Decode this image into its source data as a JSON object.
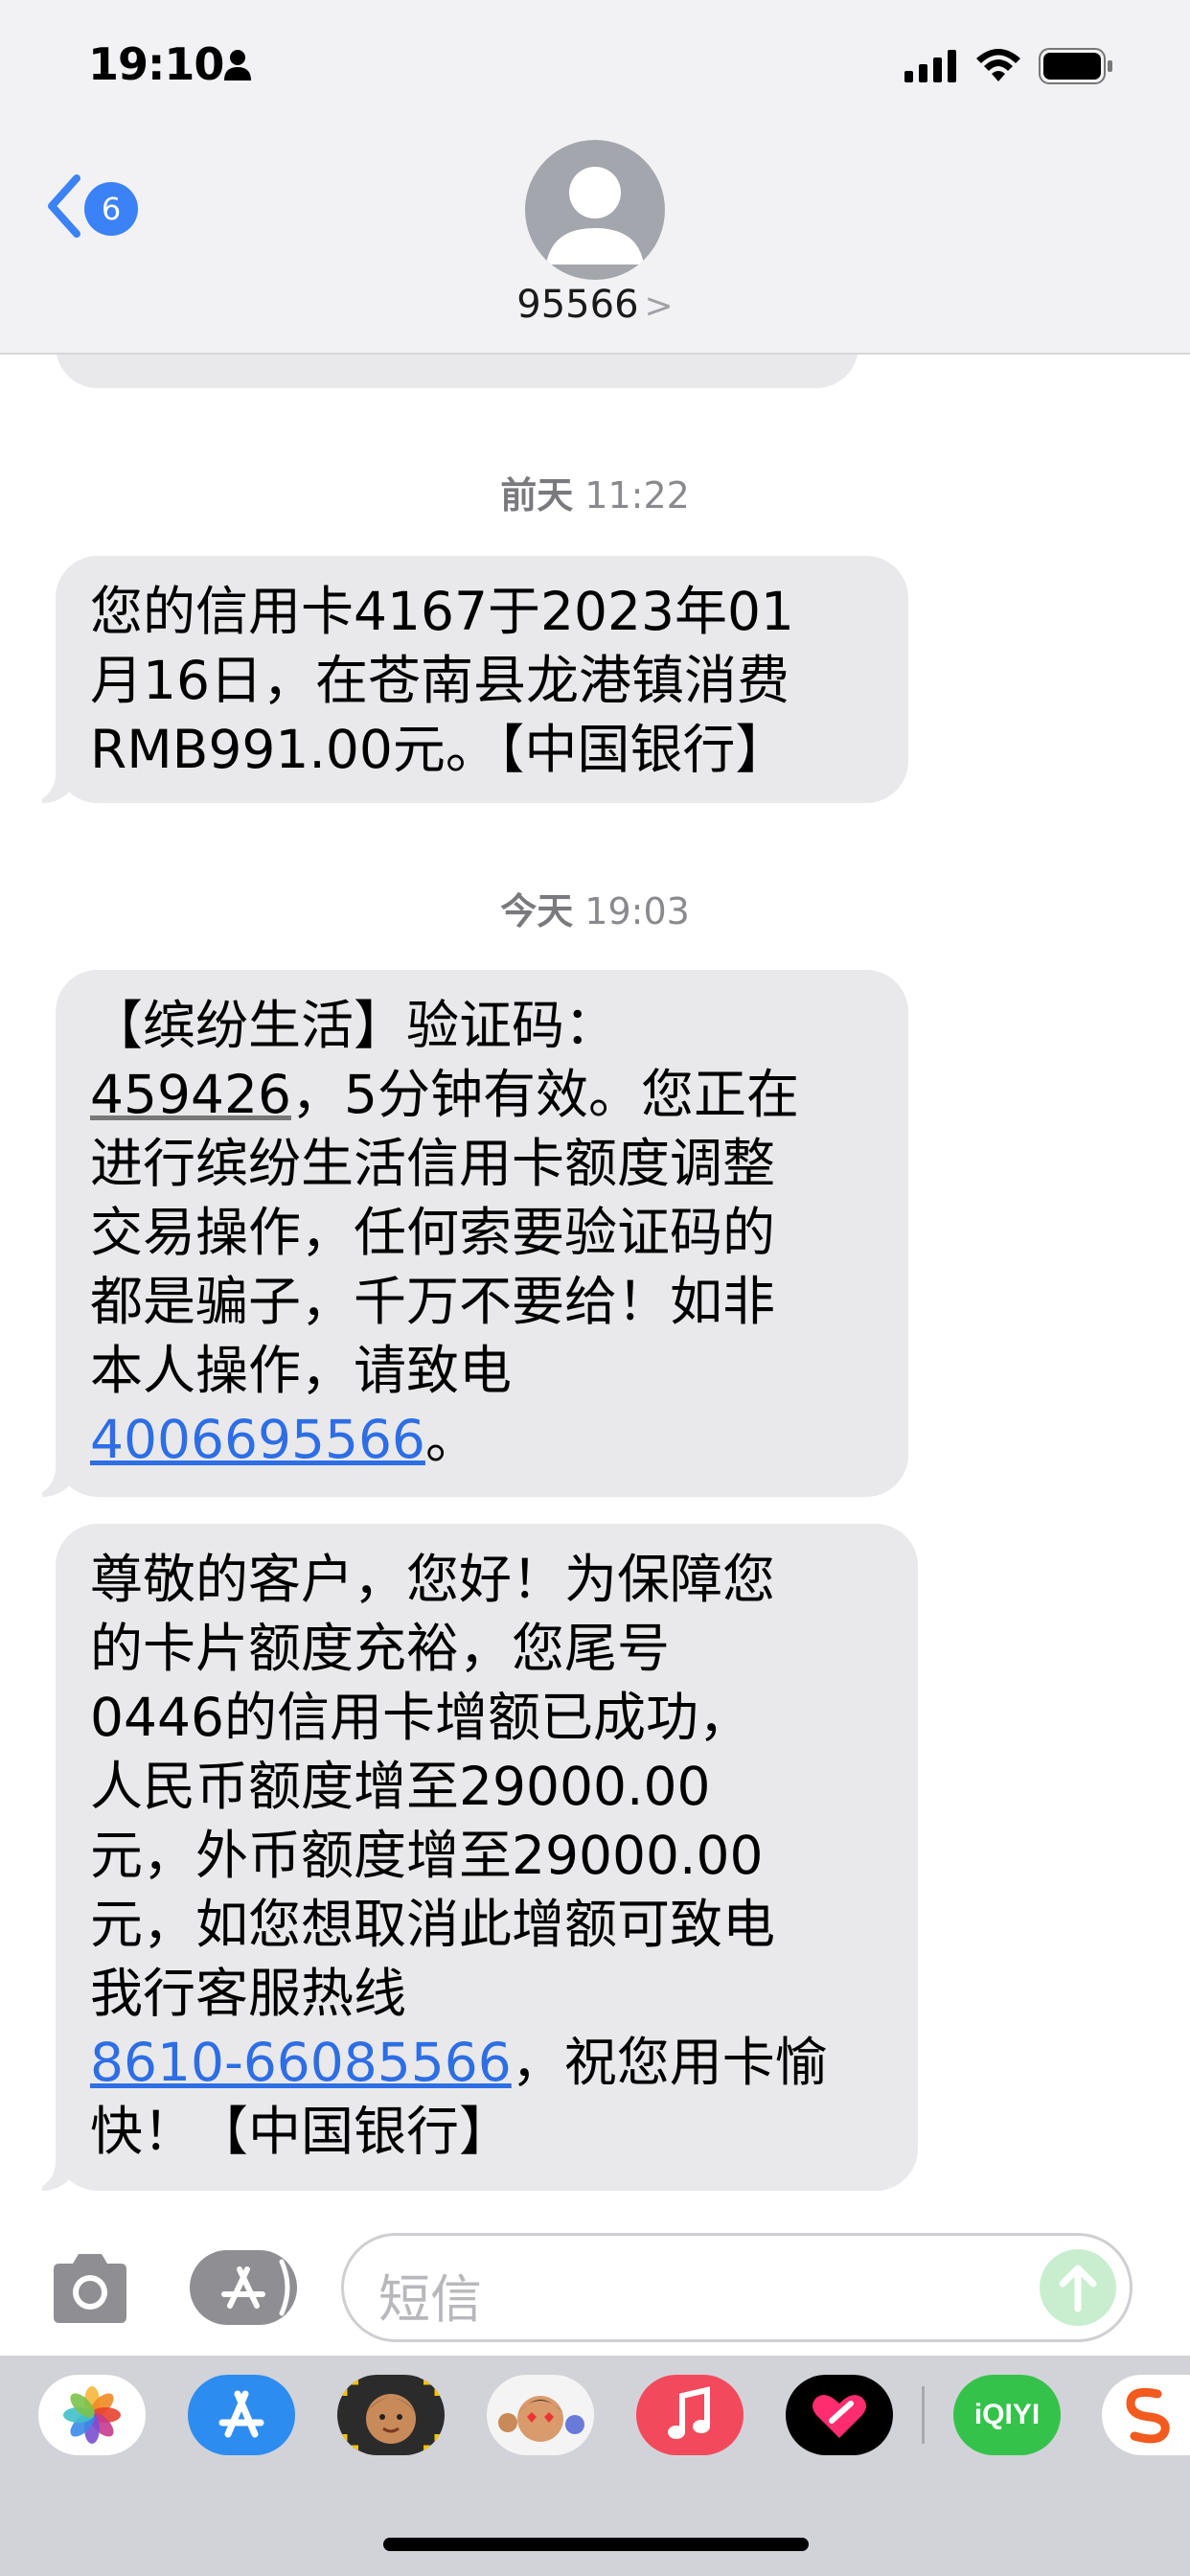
{
  "status_bar": {
    "time": "19:10"
  },
  "header": {
    "back_badge": "6",
    "contact_name": "95566",
    "contact_chevron": ">"
  },
  "messages": [
    {
      "timestamp_day": "前天",
      "timestamp_time": "11:22",
      "lines": [
        "您的信用卡4167于2023年01",
        "月16日，在苍南县龙港镇消费",
        "RMB991.00元。【中国银行】"
      ]
    },
    {
      "timestamp_day": "今天",
      "timestamp_time": "19:03",
      "lines": [
        "【缤纷生活】验证码：",
        "459426",
        "，5分钟有效。您正在",
        "进行缤纷生活信用卡额度调整",
        "交易操作，任何索要验证码的",
        "都是骗子，千万不要给！如非",
        "本人操作，请致电",
        "4006695566",
        "。"
      ]
    },
    {
      "lines": [
        "尊敬的客户，您好！为保障您",
        "的卡片额度充裕，您尾号",
        "0446的信用卡增额已成功，",
        "人民币额度增至29000.00",
        "元，外币额度增至29000.00",
        "元，如您想取消此增额可致电",
        "我行客服热线",
        "8610-66085566",
        "，祝您用卡愉",
        "快！【中国银行】"
      ]
    }
  ],
  "compose": {
    "placeholder": "短信"
  },
  "app_drawer": {
    "apps": [
      {
        "name": "photos",
        "label": ""
      },
      {
        "name": "app-store",
        "label": ""
      },
      {
        "name": "memoji-camera",
        "label": ""
      },
      {
        "name": "memoji-stickers",
        "label": ""
      },
      {
        "name": "music",
        "label": ""
      },
      {
        "name": "digital-touch",
        "label": ""
      },
      {
        "name": "iqiyi",
        "label": "iQIYI"
      },
      {
        "name": "sogou",
        "label": ""
      }
    ]
  },
  "colors": {
    "header_bg": "#f2f2f4",
    "bubble_bg": "#e9e9eb",
    "link": "#2e6ee5",
    "badge": "#3b82f6",
    "drawer_bg": "#d2d3d8"
  }
}
